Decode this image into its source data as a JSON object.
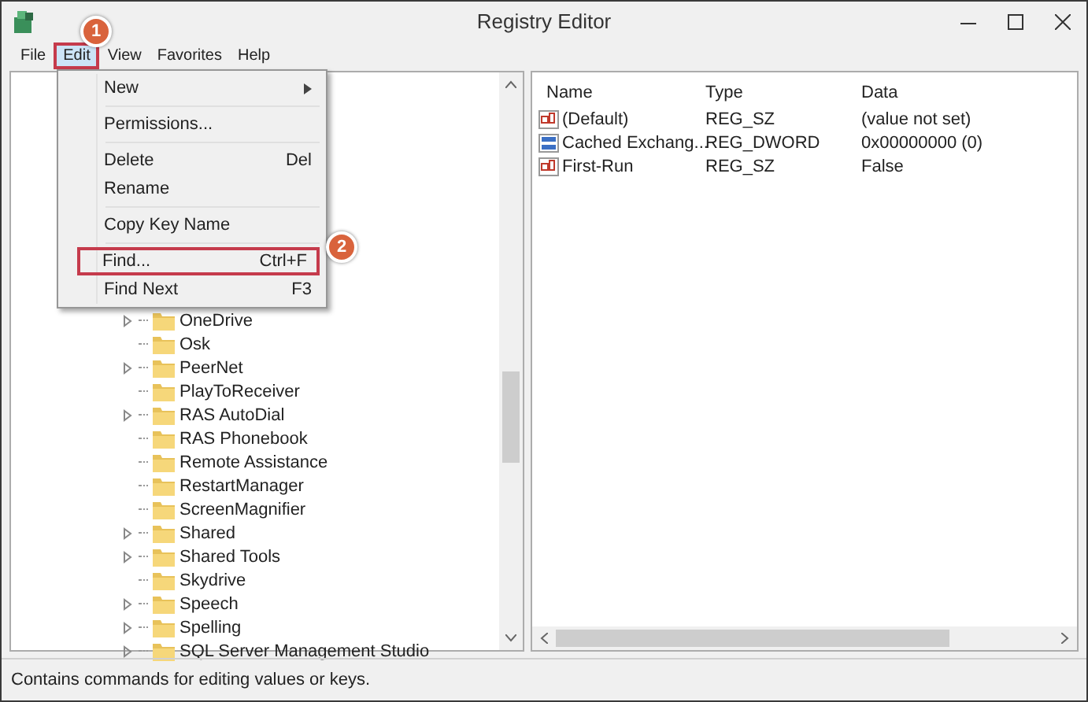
{
  "window": {
    "title": "Registry Editor"
  },
  "menu_bar": [
    {
      "label": "File",
      "selected": false,
      "outlined": false
    },
    {
      "label": "Edit",
      "selected": true,
      "outlined": true
    },
    {
      "label": "View",
      "selected": false,
      "outlined": false
    },
    {
      "label": "Favorites",
      "selected": false,
      "outlined": false
    },
    {
      "label": "Help",
      "selected": false,
      "outlined": false
    }
  ],
  "edit_menu": [
    {
      "kind": "item",
      "label": "New",
      "submenu": true,
      "outlined": false
    },
    {
      "kind": "separator"
    },
    {
      "kind": "item",
      "label": "Permissions...",
      "submenu": false,
      "outlined": false
    },
    {
      "kind": "separator"
    },
    {
      "kind": "item",
      "label": "Delete",
      "shortcut": "Del",
      "submenu": false,
      "outlined": false
    },
    {
      "kind": "item",
      "label": "Rename",
      "submenu": false,
      "outlined": false
    },
    {
      "kind": "separator"
    },
    {
      "kind": "item",
      "label": "Copy Key Name",
      "submenu": false,
      "outlined": false
    },
    {
      "kind": "separator"
    },
    {
      "kind": "item",
      "label": "Find...",
      "shortcut": "Ctrl+F",
      "submenu": false,
      "outlined": true
    },
    {
      "kind": "item",
      "label": "Find Next",
      "shortcut": "F3",
      "submenu": false,
      "outlined": false
    }
  ],
  "step_badges": [
    "1",
    "2"
  ],
  "tree": [
    {
      "label": "OneDrive",
      "expandable": true
    },
    {
      "label": "Osk",
      "expandable": false
    },
    {
      "label": "PeerNet",
      "expandable": true
    },
    {
      "label": "PlayToReceiver",
      "expandable": false
    },
    {
      "label": "RAS AutoDial",
      "expandable": true
    },
    {
      "label": "RAS Phonebook",
      "expandable": false
    },
    {
      "label": "Remote Assistance",
      "expandable": false
    },
    {
      "label": "RestartManager",
      "expandable": false
    },
    {
      "label": "ScreenMagnifier",
      "expandable": false
    },
    {
      "label": "Shared",
      "expandable": true
    },
    {
      "label": "Shared Tools",
      "expandable": true
    },
    {
      "label": "Skydrive",
      "expandable": false
    },
    {
      "label": "Speech",
      "expandable": true
    },
    {
      "label": "Spelling",
      "expandable": true
    },
    {
      "label": "SQL Server Management Studio",
      "expandable": true
    }
  ],
  "values": {
    "columns": [
      "Name",
      "Type",
      "Data"
    ],
    "rows": [
      {
        "kind": "string",
        "name": "(Default)",
        "type": "REG_SZ",
        "data": "(value not set)"
      },
      {
        "kind": "dword",
        "name": "Cached Exchang...",
        "type": "REG_DWORD",
        "data": "0x00000000 (0)"
      },
      {
        "kind": "string",
        "name": "First-Run",
        "type": "REG_SZ",
        "data": "False"
      }
    ]
  },
  "status_bar": "Contains commands for editing values or keys."
}
